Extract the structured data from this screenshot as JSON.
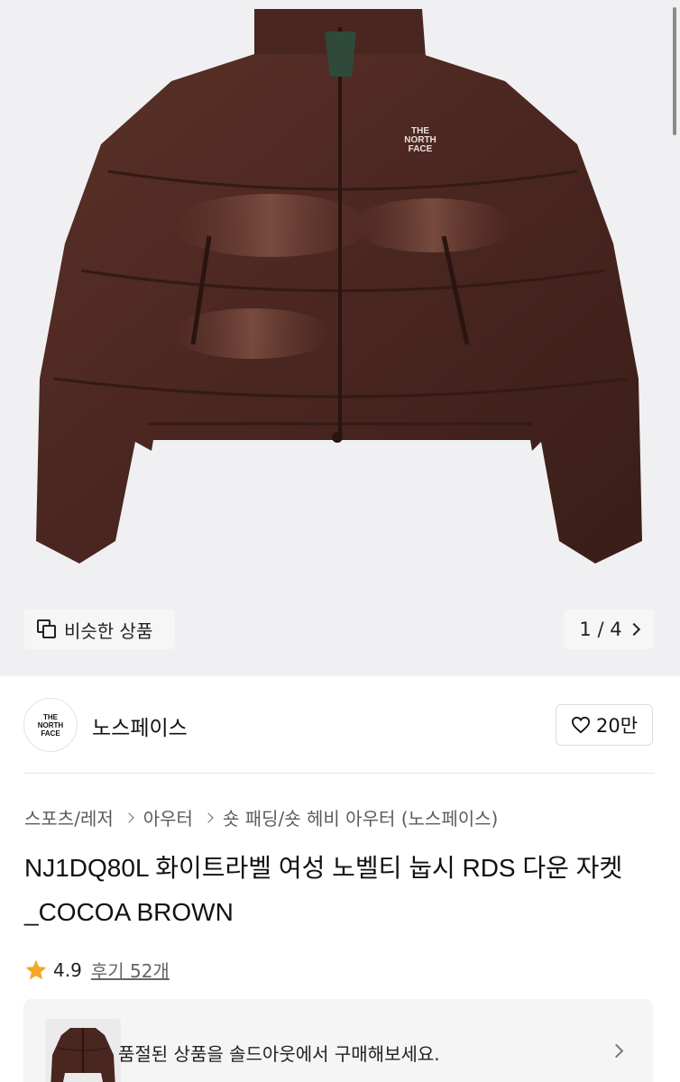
{
  "gallery": {
    "similar_label": "비슷한 상품",
    "page_indicator": "1 / 4",
    "product_logo_text": "THE NORTH FACE"
  },
  "shop": {
    "name": "노스페이스",
    "logo_text": "THE NORTH FACE",
    "like_count": "20만"
  },
  "category": [
    "스포츠/레저",
    "아우터",
    "숏 패딩/숏 헤비 아우터 (노스페이스)"
  ],
  "product": {
    "title": "NJ1DQ80L 화이트라벨 여성 노벨티 눕시 RDS 다운 자켓_COCOA BROWN"
  },
  "rating": {
    "score": "4.9",
    "reviews": "후기 52개"
  },
  "soldout_banner": {
    "text": "품절된 상품을 솔드아웃에서 구매해보세요."
  },
  "colors": {
    "jacket": "#4a2620",
    "background": "#f0f0f2",
    "star": "#f5a623"
  }
}
